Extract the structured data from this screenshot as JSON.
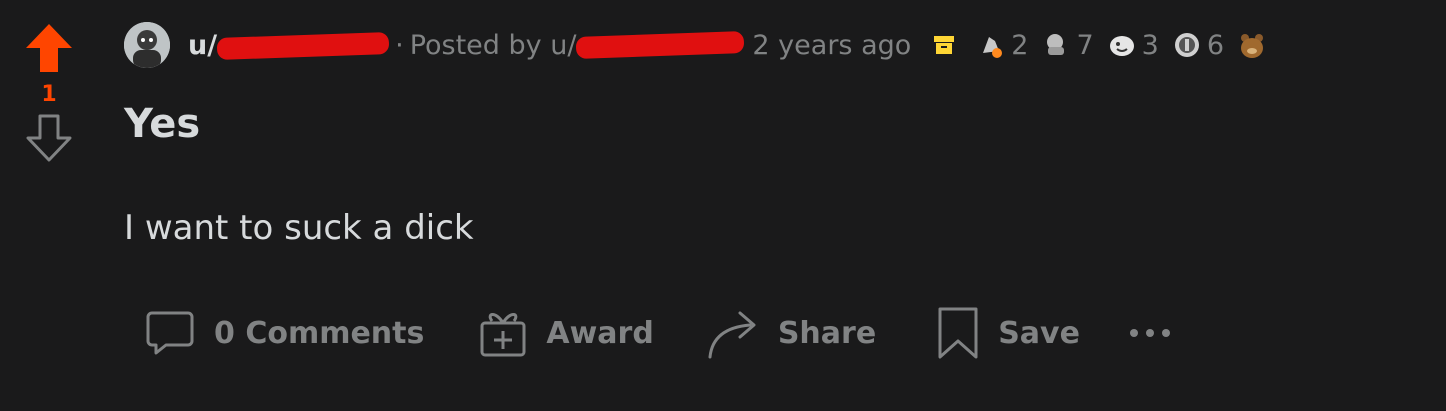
{
  "post": {
    "vote_count": "1",
    "author_prefix": "u/",
    "posted_by_label": "Posted by u/",
    "time": "2 years ago",
    "title": "Yes",
    "body": "I want to suck a dick"
  },
  "awards": [
    {
      "icon": "silver-award-icon",
      "count": "2"
    },
    {
      "icon": "helpful-award-icon",
      "count": "7"
    },
    {
      "icon": "wholesome-award-icon",
      "count": "3"
    },
    {
      "icon": "coin-award-icon",
      "count": "6"
    }
  ],
  "actions": {
    "comments_label": "0 Comments",
    "award_label": "Award",
    "share_label": "Share",
    "save_label": "Save"
  },
  "colors": {
    "background": "#1a1a1b",
    "upvote": "#ff4500",
    "text": "#d7dadc",
    "meta": "#818384",
    "archive": "#ffd635"
  }
}
